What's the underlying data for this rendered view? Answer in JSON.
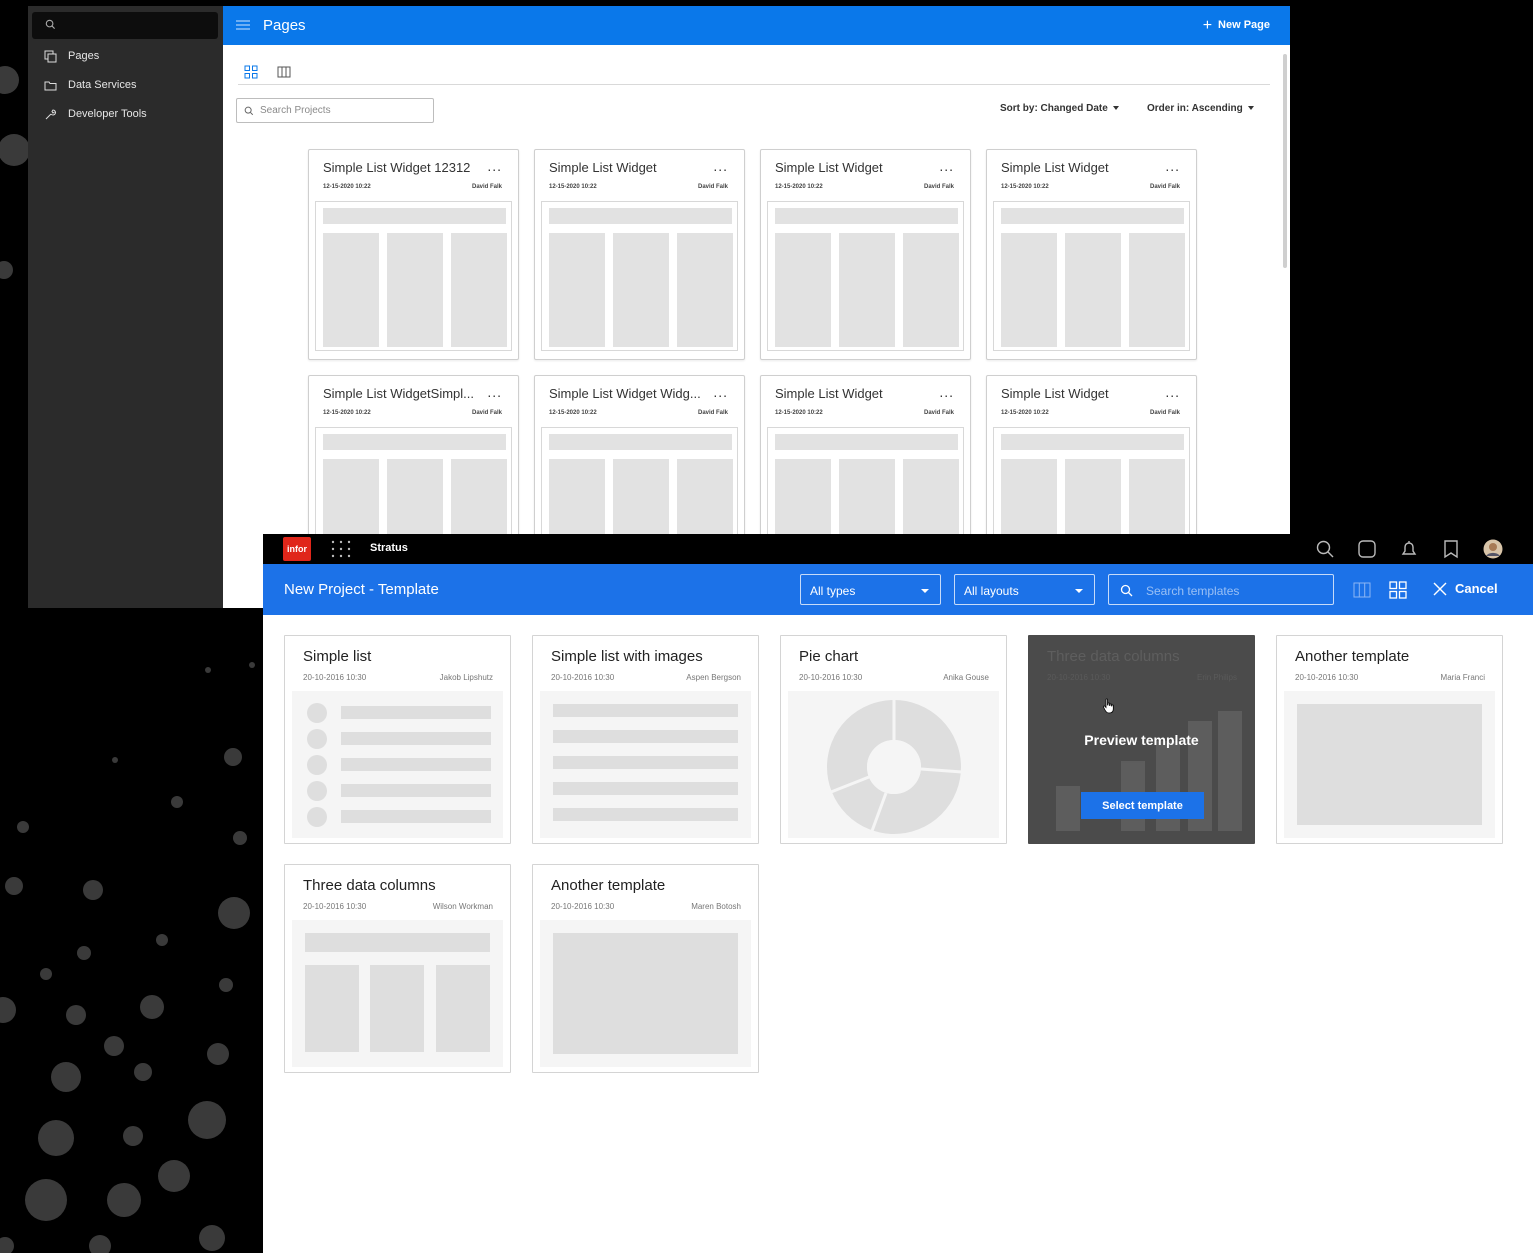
{
  "back_window": {
    "sidebar": {
      "search_placeholder": "",
      "items": [
        {
          "label": "Pages",
          "icon": "pages-icon"
        },
        {
          "label": "Data Services",
          "icon": "folder-icon"
        },
        {
          "label": "Developer Tools",
          "icon": "wrench-icon"
        }
      ]
    },
    "header": {
      "title": "Pages",
      "new_page": "New Page"
    },
    "toolbar": {
      "search_placeholder": "Search Projects",
      "sort_by": "Sort by: Changed Date",
      "order_in": "Order in: Ascending"
    },
    "cards": [
      {
        "title": "Simple List Widget 12312",
        "date": "12-15-2020 10:22",
        "author": "David Falk"
      },
      {
        "title": "Simple List Widget",
        "date": "12-15-2020 10:22",
        "author": "David Falk"
      },
      {
        "title": "Simple List Widget",
        "date": "12-15-2020 10:22",
        "author": "David Falk"
      },
      {
        "title": "Simple List Widget",
        "date": "12-15-2020 10:22",
        "author": "David Falk"
      },
      {
        "title": "Simple List WidgetSimpl...",
        "date": "12-15-2020 10:22",
        "author": "David Falk"
      },
      {
        "title": "Simple List Widget Widg...",
        "date": "12-15-2020 10:22",
        "author": "David Falk"
      },
      {
        "title": "Simple List Widget",
        "date": "12-15-2020 10:22",
        "author": "David Falk"
      },
      {
        "title": "Simple List Widget",
        "date": "12-15-2020 10:22",
        "author": "David Falk"
      }
    ],
    "more_label": "..."
  },
  "front_window": {
    "topbar": {
      "logo": "infor",
      "app_name": "Stratus"
    },
    "header": {
      "title": "New Project - Template",
      "type_filter": "All types",
      "layout_filter": "All layouts",
      "search_placeholder": "Search templates",
      "cancel": "Cancel"
    },
    "templates": [
      {
        "title": "Simple list",
        "date": "20-10-2016 10:30",
        "author": "Jakob Lipshutz"
      },
      {
        "title": "Simple list with images",
        "date": "20-10-2016 10:30",
        "author": "Aspen Bergson"
      },
      {
        "title": "Pie chart",
        "date": "20-10-2016 10:30",
        "author": "Anika Gouse"
      },
      {
        "title": "Three data  columns",
        "date": "20-10-2016 10:30",
        "author": "Erin Philips"
      },
      {
        "title": "Another template",
        "date": "20-10-2016 10:30",
        "author": "Maria Franci"
      },
      {
        "title": "Three data  columns",
        "date": "20-10-2016 10:30",
        "author": "Wilson Workman"
      },
      {
        "title": "Another template",
        "date": "20-10-2016 10:30",
        "author": "Maren Botosh"
      }
    ],
    "hover_overlay": {
      "preview": "Preview template",
      "select": "Select template"
    }
  },
  "colors": {
    "brand_blue": "#1c72e8",
    "back_header_blue": "#0a78ea",
    "infor_red": "#e0261a",
    "sidebar": "#2b2b2b"
  }
}
